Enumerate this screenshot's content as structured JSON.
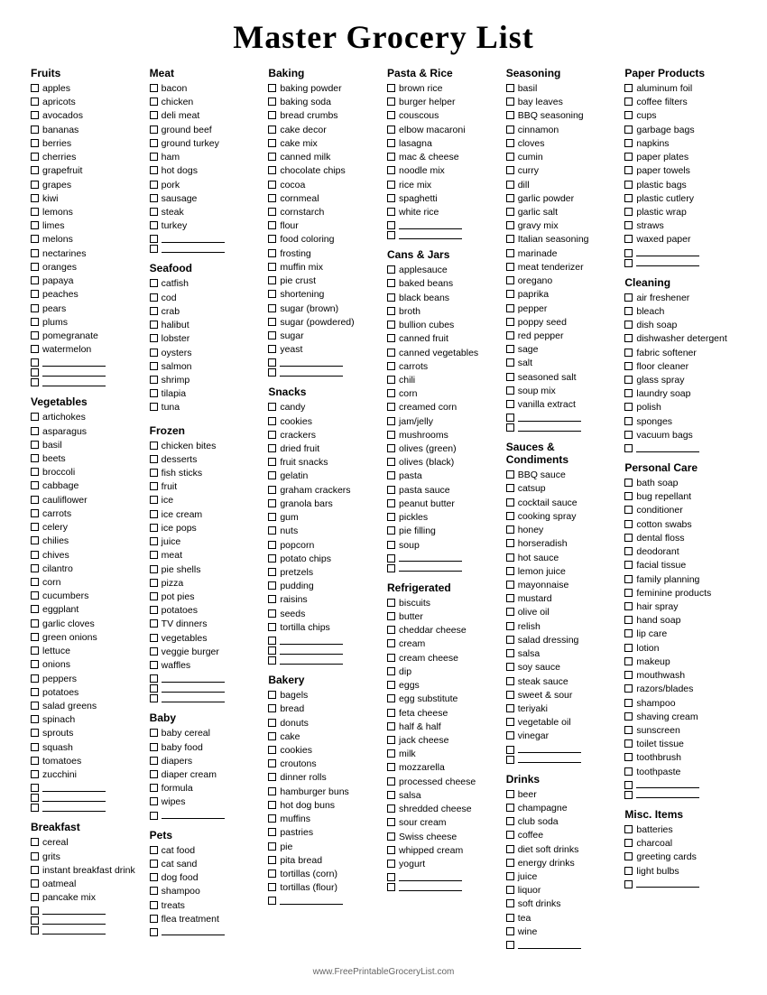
{
  "title": "Master Grocery List",
  "footer": "www.FreePrintableGroceryList.com",
  "columns": [
    {
      "sections": [
        {
          "title": "Fruits",
          "items": [
            "apples",
            "apricots",
            "avocados",
            "bananas",
            "berries",
            "cherries",
            "grapefruit",
            "grapes",
            "kiwi",
            "lemons",
            "limes",
            "melons",
            "nectarines",
            "oranges",
            "papaya",
            "peaches",
            "pears",
            "plums",
            "pomegranate",
            "watermelon"
          ],
          "blanks": 3
        },
        {
          "title": "Vegetables",
          "items": [
            "artichokes",
            "asparagus",
            "basil",
            "beets",
            "broccoli",
            "cabbage",
            "cauliflower",
            "carrots",
            "celery",
            "chilies",
            "chives",
            "cilantro",
            "corn",
            "cucumbers",
            "eggplant",
            "garlic cloves",
            "green onions",
            "lettuce",
            "onions",
            "peppers",
            "potatoes",
            "salad greens",
            "spinach",
            "sprouts",
            "squash",
            "tomatoes",
            "zucchini"
          ],
          "blanks": 3
        },
        {
          "title": "Breakfast",
          "items": [
            "cereal",
            "grits",
            "instant breakfast drink",
            "oatmeal",
            "pancake mix"
          ],
          "blanks": 3
        }
      ]
    },
    {
      "sections": [
        {
          "title": "Meat",
          "items": [
            "bacon",
            "chicken",
            "deli meat",
            "ground beef",
            "ground turkey",
            "ham",
            "hot dogs",
            "pork",
            "sausage",
            "steak",
            "turkey"
          ],
          "blanks": 2
        },
        {
          "title": "Seafood",
          "items": [
            "catfish",
            "cod",
            "crab",
            "halibut",
            "lobster",
            "oysters",
            "salmon",
            "shrimp",
            "tilapia",
            "tuna"
          ],
          "blanks": 0
        },
        {
          "title": "Frozen",
          "items": [
            "chicken bites",
            "desserts",
            "fish sticks",
            "fruit",
            "ice",
            "ice cream",
            "ice pops",
            "juice",
            "meat",
            "pie shells",
            "pizza",
            "pot pies",
            "potatoes",
            "TV dinners",
            "vegetables",
            "veggie burger",
            "waffles"
          ],
          "blanks": 3
        },
        {
          "title": "Baby",
          "items": [
            "baby cereal",
            "baby food",
            "diapers",
            "diaper cream",
            "formula",
            "wipes"
          ],
          "blanks": 1
        },
        {
          "title": "Pets",
          "items": [
            "cat food",
            "cat sand",
            "dog food",
            "shampoo",
            "treats",
            "flea treatment"
          ],
          "blanks": 1
        }
      ]
    },
    {
      "sections": [
        {
          "title": "Baking",
          "items": [
            "baking powder",
            "baking soda",
            "bread crumbs",
            "cake decor",
            "cake mix",
            "canned milk",
            "chocolate chips",
            "cocoa",
            "cornmeal",
            "cornstarch",
            "flour",
            "food coloring",
            "frosting",
            "muffin mix",
            "pie crust",
            "shortening",
            "sugar (brown)",
            "sugar (powdered)",
            "sugar",
            "yeast"
          ],
          "blanks": 2
        },
        {
          "title": "Snacks",
          "items": [
            "candy",
            "cookies",
            "crackers",
            "dried fruit",
            "fruit snacks",
            "gelatin",
            "graham crackers",
            "granola bars",
            "gum",
            "nuts",
            "popcorn",
            "potato chips",
            "pretzels",
            "pudding",
            "raisins",
            "seeds",
            "tortilla chips"
          ],
          "blanks": 3
        },
        {
          "title": "Bakery",
          "items": [
            "bagels",
            "bread",
            "donuts",
            "cake",
            "cookies",
            "croutons",
            "dinner rolls",
            "hamburger buns",
            "hot dog buns",
            "muffins",
            "pastries",
            "pie",
            "pita bread",
            "tortillas (corn)",
            "tortillas (flour)"
          ],
          "blanks": 1
        }
      ]
    },
    {
      "sections": [
        {
          "title": "Pasta & Rice",
          "items": [
            "brown rice",
            "burger helper",
            "couscous",
            "elbow macaroni",
            "lasagna",
            "mac & cheese",
            "noodle mix",
            "rice mix",
            "spaghetti",
            "white rice"
          ],
          "blanks": 2
        },
        {
          "title": "Cans & Jars",
          "items": [
            "applesauce",
            "baked beans",
            "black beans",
            "broth",
            "bullion cubes",
            "canned fruit",
            "canned vegetables",
            "carrots",
            "chili",
            "corn",
            "creamed corn",
            "jam/jelly",
            "mushrooms",
            "olives (green)",
            "olives (black)",
            "pasta",
            "pasta sauce",
            "peanut butter",
            "pickles",
            "pie filling",
            "soup"
          ],
          "blanks": 2
        },
        {
          "title": "Refrigerated",
          "items": [
            "biscuits",
            "butter",
            "cheddar cheese",
            "cream",
            "cream cheese",
            "dip",
            "eggs",
            "egg substitute",
            "feta cheese",
            "half & half",
            "jack cheese",
            "milk",
            "mozzarella",
            "processed cheese",
            "salsa",
            "shredded cheese",
            "sour cream",
            "Swiss cheese",
            "whipped cream",
            "yogurt"
          ],
          "blanks": 2
        }
      ]
    },
    {
      "sections": [
        {
          "title": "Seasoning",
          "items": [
            "basil",
            "bay leaves",
            "BBQ seasoning",
            "cinnamon",
            "cloves",
            "cumin",
            "curry",
            "dill",
            "garlic powder",
            "garlic salt",
            "gravy mix",
            "Italian seasoning",
            "marinade",
            "meat tenderizer",
            "oregano",
            "paprika",
            "pepper",
            "poppy seed",
            "red pepper",
            "sage",
            "salt",
            "seasoned salt",
            "soup mix",
            "vanilla extract"
          ],
          "blanks": 2
        },
        {
          "title": "Sauces & Condiments",
          "items": [
            "BBQ sauce",
            "catsup",
            "cocktail sauce",
            "cooking spray",
            "honey",
            "horseradish",
            "hot sauce",
            "lemon juice",
            "mayonnaise",
            "mustard",
            "olive oil",
            "relish",
            "salad dressing",
            "salsa",
            "soy sauce",
            "steak sauce",
            "sweet & sour",
            "teriyaki",
            "vegetable oil",
            "vinegar"
          ],
          "blanks": 2
        },
        {
          "title": "Drinks",
          "items": [
            "beer",
            "champagne",
            "club soda",
            "coffee",
            "diet soft drinks",
            "energy drinks",
            "juice",
            "liquor",
            "soft drinks",
            "tea",
            "wine"
          ],
          "blanks": 1
        }
      ]
    },
    {
      "sections": [
        {
          "title": "Paper Products",
          "items": [
            "aluminum foil",
            "coffee filters",
            "cups",
            "garbage bags",
            "napkins",
            "paper plates",
            "paper towels",
            "plastic bags",
            "plastic cutlery",
            "plastic wrap",
            "straws",
            "waxed paper"
          ],
          "blanks": 2
        },
        {
          "title": "Cleaning",
          "items": [
            "air freshener",
            "bleach",
            "dish soap",
            "dishwasher detergent",
            "fabric softener",
            "floor cleaner",
            "glass spray",
            "laundry soap",
            "polish",
            "sponges",
            "vacuum bags"
          ],
          "blanks": 1
        },
        {
          "title": "Personal Care",
          "items": [
            "bath soap",
            "bug repellant",
            "conditioner",
            "cotton swabs",
            "dental floss",
            "deodorant",
            "facial tissue",
            "family planning",
            "feminine products",
            "hair spray",
            "hand soap",
            "lip care",
            "lotion",
            "makeup",
            "mouthwash",
            "razors/blades",
            "shampoo",
            "shaving cream",
            "sunscreen",
            "toilet tissue",
            "toothbrush",
            "toothpaste"
          ],
          "blanks": 2
        },
        {
          "title": "Misc. Items",
          "items": [
            "batteries",
            "charcoal",
            "greeting cards",
            "light bulbs"
          ],
          "blanks": 1
        }
      ]
    }
  ]
}
